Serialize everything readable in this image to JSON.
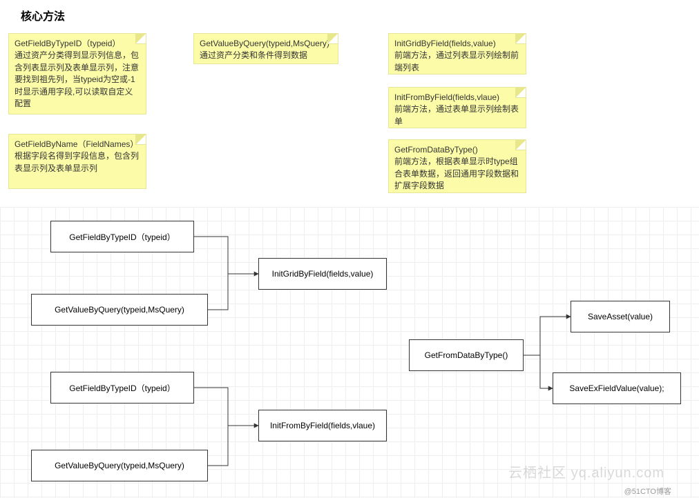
{
  "title": "核心方法",
  "notes": [
    {
      "id": "n1",
      "title": "GetFieldByTypeID（typeid）",
      "desc": "通过资产分类得到显示列信息，包含列表显示列及表单显示列，注意要找到祖先列，当typeid为空或-1时显示通用字段,可以读取自定义配置"
    },
    {
      "id": "n2",
      "title": "GetValueByQuery(typeid,MsQuery)",
      "desc": "通过资产分类和条件得到数据"
    },
    {
      "id": "n3",
      "title": "InitGridByField(fields,value)",
      "desc": "前端方法，通过列表显示列绘制前端列表"
    },
    {
      "id": "n4",
      "title": "InitFromByField(fields,vlaue)",
      "desc": "前端方法，通过表单显示列绘制表单"
    },
    {
      "id": "n5",
      "title": "GetFromDataByType()",
      "desc": "前端方法，根据表单显示时type组合表单数据，返回通用字段数据和扩展字段数据"
    },
    {
      "id": "n6",
      "title": "GetFieldByName（FieldNames）",
      "desc": "根据字段名得到字段信息，包含列表显示列及表单显示列"
    }
  ],
  "boxes": {
    "b1": "GetFieldByTypeID（typeid）",
    "b2": "GetValueByQuery(typeid,MsQuery)",
    "b3": "InitGridByField(fields,value)",
    "b4": "GetFieldByTypeID（typeid）",
    "b5": "GetValueByQuery(typeid,MsQuery)",
    "b6": "InitFromByField(fields,vlaue)",
    "b7": "GetFromDataByType()",
    "b8": "SaveAsset(value)",
    "b9": "SaveExFieldValue(value);"
  },
  "watermark": "@51CTO博客",
  "watermark2": "云栖社区 yq.aliyun.com"
}
